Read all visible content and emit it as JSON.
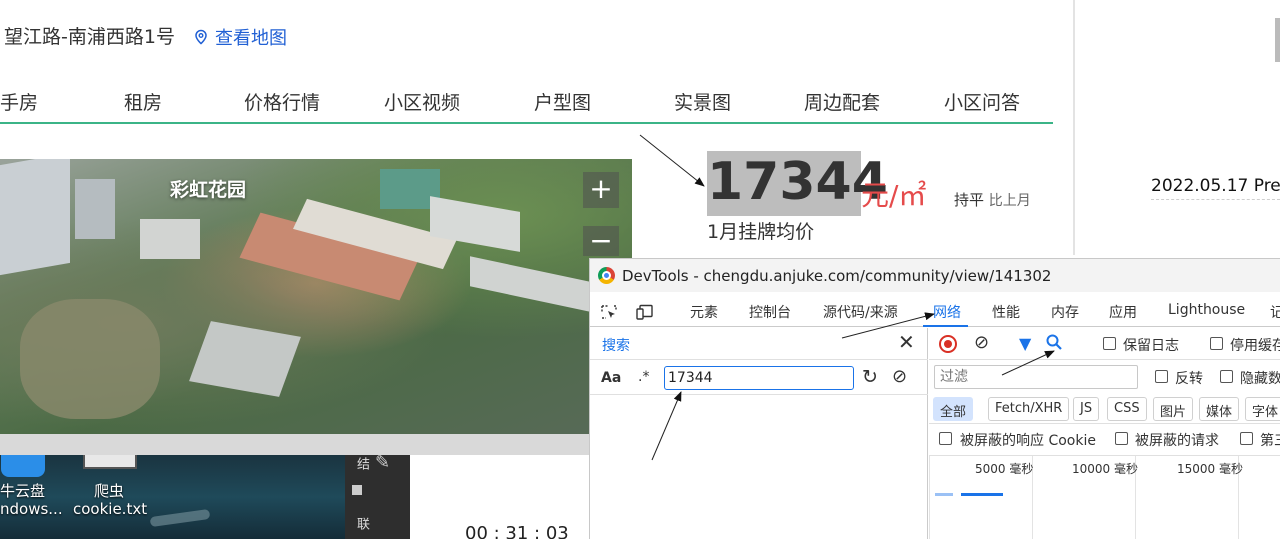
{
  "page": {
    "address": "望江路-南浦西路1号",
    "map_link": "查看地图",
    "nav": [
      "手房",
      "租房",
      "价格行情",
      "小区视频",
      "户型图",
      "实景图",
      "周边配套",
      "小区问答"
    ],
    "photo_label": "彩虹花园",
    "zoom_in": "+",
    "zoom_out": "−",
    "price": "17344",
    "price_unit": "元/㎡",
    "trend": "持平",
    "trend_basis": "比上月",
    "price_desc": "1月挂牌均价",
    "right_date": "2022.05.17 Pre"
  },
  "desktop": {
    "icon1_line1": "牛云盘",
    "icon1_line2": "ndows...",
    "icon2_line1": "爬虫",
    "icon2_line2": "cookie.txt",
    "side_text_1": "结",
    "side_text_2": "联",
    "clock": "00 : 31 : 03"
  },
  "devtools": {
    "title": "DevTools - chengdu.anjuke.com/community/view/141302",
    "tabs": [
      "元素",
      "控制台",
      "源代码/来源",
      "网络",
      "性能",
      "内存",
      "应用",
      "Lighthouse",
      "记"
    ],
    "active_tab": "网络",
    "search_title": "搜索",
    "search_aa": "Aa",
    "search_regex": ".*",
    "search_value": "17344",
    "preserve_log": "保留日志",
    "disable_cache": "停用缓存",
    "filter_placeholder": "过滤",
    "invert": "反转",
    "hide_data": "隐藏数",
    "types": [
      "全部",
      "Fetch/XHR",
      "JS",
      "CSS",
      "图片",
      "媒体",
      "字体"
    ],
    "blocked_cookies": "被屏蔽的响应 Cookie",
    "blocked_requests": "被屏蔽的请求",
    "third_party": "第三",
    "timeline_labels": [
      "5000 毫秒",
      "10000 毫秒",
      "15000 毫秒"
    ]
  }
}
